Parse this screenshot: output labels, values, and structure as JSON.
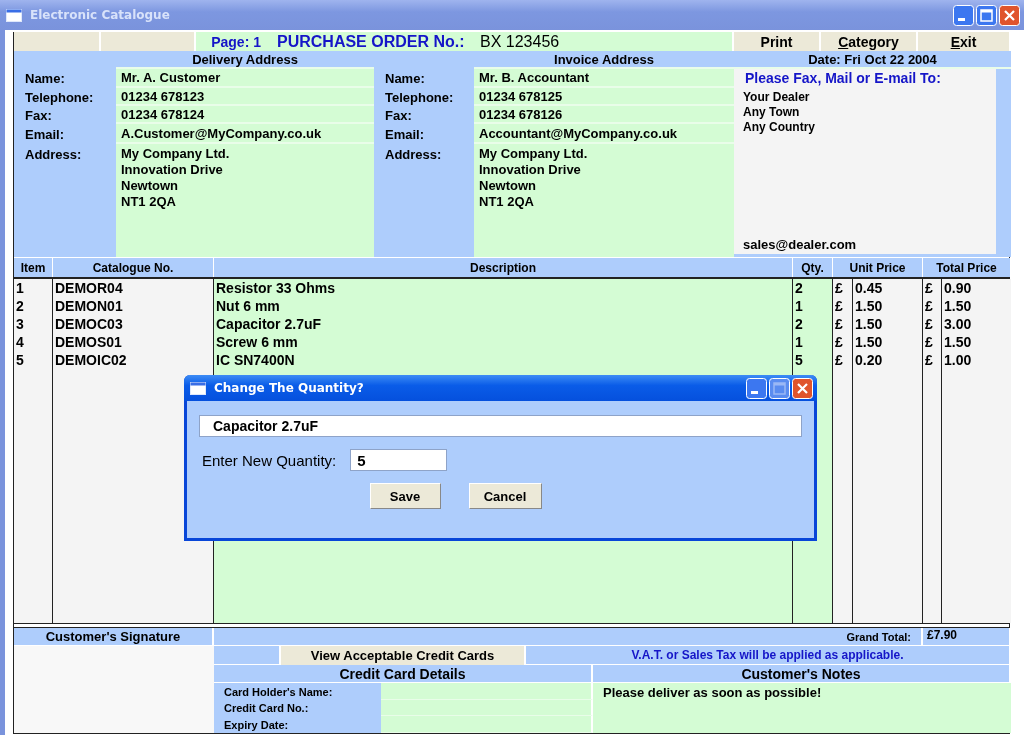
{
  "window": {
    "title": "Electronic Catalogue"
  },
  "header": {
    "page": "Page: 1",
    "po_label": "PURCHASE ORDER No.:",
    "po_number": "BX 123456",
    "buttons": [
      {
        "label": "Print",
        "mnemonic": false
      },
      {
        "label": "Category",
        "mnemonic": true
      },
      {
        "label": "Exit",
        "mnemonic": true
      }
    ]
  },
  "delivery": {
    "heading": "Delivery Address",
    "fields": [
      {
        "label": "Name:",
        "value": "Mr. A. Customer"
      },
      {
        "label": "Telephone:",
        "value": "01234 678123"
      },
      {
        "label": "Fax:",
        "value": "01234 678124"
      },
      {
        "label": "Email:",
        "value": "A.Customer@MyCompany.co.uk"
      }
    ],
    "address_label": "Address:",
    "address_lines": [
      "My Company Ltd.",
      "Innovation Drive",
      "Newtown",
      "NT1 2QA"
    ]
  },
  "invoice": {
    "heading": "Invoice Address",
    "fields": [
      {
        "label": "Name:",
        "value": "Mr. B. Accountant"
      },
      {
        "label": "Telephone:",
        "value": "01234 678125"
      },
      {
        "label": "Fax:",
        "value": "01234 678126"
      },
      {
        "label": "Email:",
        "value": "Accountant@MyCompany.co.uk"
      }
    ],
    "address_label": "Address:",
    "address_lines": [
      "My Company Ltd.",
      "Innovation Drive",
      "Newtown",
      "NT1 2QA"
    ]
  },
  "send_to": {
    "date": "Date: Fri Oct 22 2004",
    "heading": "Please Fax, Mail or E-mail To:",
    "lines": [
      "Your Dealer",
      "Any Town",
      "Any Country"
    ],
    "email": "sales@dealer.com"
  },
  "table": {
    "columns": [
      "Item",
      "Catalogue No.",
      "Description",
      "Qty.",
      "Unit Price",
      "Total Price"
    ],
    "rows": [
      {
        "item": "1",
        "catalogue_no": "DEMOR04",
        "description": "Resistor 33 Ohms",
        "qty": "2",
        "unit_currency": "£",
        "unit_price": "0.45",
        "total_currency": "£",
        "total_price": "0.90"
      },
      {
        "item": "2",
        "catalogue_no": "DEMON01",
        "description": "Nut 6 mm",
        "qty": "1",
        "unit_currency": "£",
        "unit_price": "1.50",
        "total_currency": "£",
        "total_price": "1.50"
      },
      {
        "item": "3",
        "catalogue_no": "DEMOC03",
        "description": "Capacitor 2.7uF",
        "qty": "2",
        "unit_currency": "£",
        "unit_price": "1.50",
        "total_currency": "£",
        "total_price": "3.00"
      },
      {
        "item": "4",
        "catalogue_no": "DEMOS01",
        "description": "Screw 6 mm",
        "qty": "1",
        "unit_currency": "£",
        "unit_price": "1.50",
        "total_currency": "£",
        "total_price": "1.50"
      },
      {
        "item": "5",
        "catalogue_no": "DEMOIC02",
        "description": "IC SN7400N",
        "qty": "5",
        "unit_currency": "£",
        "unit_price": "0.20",
        "total_currency": "£",
        "total_price": "1.00"
      }
    ]
  },
  "footer": {
    "signature_label": "Customer's Signature",
    "grand_total_label": "Grand Total:",
    "grand_total": "£7.90",
    "credit_cards_button": "View Acceptable Credit Cards",
    "vat_note": "V.A.T. or Sales Tax will be applied as applicable.",
    "card_heading": "Credit Card Details",
    "card_fields": [
      "Card Holder's Name:",
      "Credit Card No.:",
      "Expiry Date:"
    ],
    "notes_heading": "Customer's Notes",
    "notes": "Please deliver as soon as possible!"
  },
  "dialog": {
    "title": "Change The Quantity?",
    "item": "Capacitor 2.7uF",
    "quantity_label": "Enter New Quantity:",
    "quantity": "5",
    "buttons": [
      "Save",
      "Cancel"
    ]
  }
}
